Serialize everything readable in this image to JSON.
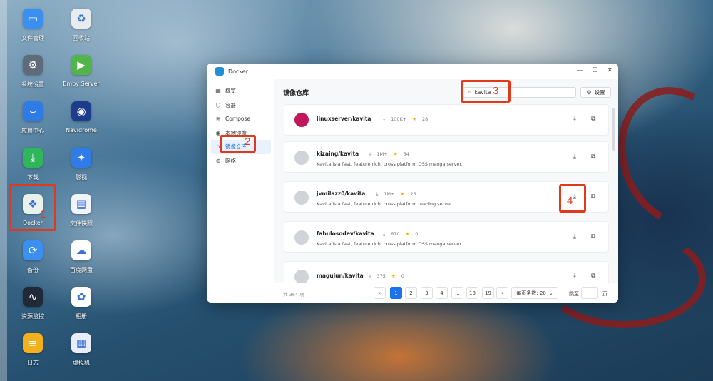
{
  "desktop": {
    "icons": [
      {
        "label": "文件管理",
        "icon": "folder-icon",
        "color": "#3b8ff0"
      },
      {
        "label": "回收站",
        "icon": "recycle-bin-icon",
        "color": "#e9ecef"
      },
      {
        "label": "系统设置",
        "icon": "gear-icon",
        "color": "#5f6b7a"
      },
      {
        "label": "Emby Server",
        "icon": "emby-play-icon",
        "color": "#52b54b"
      },
      {
        "label": "应用中心",
        "icon": "store-icon",
        "color": "#2f7ce8"
      },
      {
        "label": "Navidrome",
        "icon": "navidrome-disc-icon",
        "color": "#1c3d8c"
      },
      {
        "label": "下载",
        "icon": "download-arrow-icon",
        "color": "#2fb65a"
      },
      {
        "label": "影视",
        "icon": "film-icon",
        "color": "#2f7ce8"
      },
      {
        "label": "Docker",
        "icon": "docker-whale-icon",
        "color": "#e8f2ea"
      },
      {
        "label": "文件快照",
        "icon": "file-snapshot-icon",
        "color": "#f0f4fb"
      },
      {
        "label": "备份",
        "icon": "backup-sync-icon",
        "color": "#3b8ff0"
      },
      {
        "label": "百度网盘",
        "icon": "baidu-cloud-icon",
        "color": "#ffffff"
      },
      {
        "label": "资源监控",
        "icon": "monitor-chart-icon",
        "color": "#1f2937"
      },
      {
        "label": "相册",
        "icon": "photos-flower-icon",
        "color": "#ffffff"
      },
      {
        "label": "日志",
        "icon": "log-list-icon",
        "color": "#f2b01e"
      },
      {
        "label": "虚拟机",
        "icon": "virtual-machine-icon",
        "color": "#e8eef9"
      }
    ]
  },
  "annotations": [
    "1",
    "2",
    "3",
    "4"
  ],
  "window": {
    "title": "Docker",
    "controls": {
      "minimize": "—",
      "maximize": "☐",
      "close": "✕"
    },
    "sidebar": [
      {
        "label": "概览",
        "icon": "grid-icon",
        "active": false
      },
      {
        "label": "容器",
        "icon": "cube-icon",
        "active": false
      },
      {
        "label": "Compose",
        "icon": "compose-icon",
        "active": false
      },
      {
        "label": "本地镜像",
        "icon": "eye-icon",
        "active": false
      },
      {
        "label": "镜像仓库",
        "icon": "home-icon",
        "active": true
      },
      {
        "label": "网络",
        "icon": "globe-icon",
        "active": false
      }
    ],
    "main": {
      "title": "镜像仓库",
      "search_value": "kavita",
      "settings_label": "设置",
      "results": [
        {
          "name": "linuxserver/kavita",
          "downloads": "100K+",
          "stars": "28",
          "description": "",
          "logo_color": "#c2185b"
        },
        {
          "name": "kizaing/kavita",
          "downloads": "1M+",
          "stars": "54",
          "description": "Kavita is a fast, feature rich, cross platform OSS manga server.",
          "logo_color": "#d0d3d8"
        },
        {
          "name": "jvmilazz0/kavita",
          "downloads": "1M+",
          "stars": "25",
          "description": "Kavita is a fast, feature rich, cross platform reading server.",
          "logo_color": "#d0d3d8"
        },
        {
          "name": "fabulosodev/kavita",
          "downloads": "670",
          "stars": "0",
          "description": "Kavita is a fast, feature rich, cross platform OSS manga server.",
          "logo_color": "#d0d3d8"
        },
        {
          "name": "magujun/kavita",
          "downloads": "375",
          "stars": "0",
          "description": "",
          "logo_color": "#d0d3d8"
        }
      ]
    },
    "pagination": {
      "total": "共 364 项",
      "prev": "‹",
      "next": "›",
      "pages": [
        "1",
        "2",
        "3",
        "4",
        "...",
        "18",
        "19"
      ],
      "current": "1",
      "per_page": "每页条数: 20",
      "jump_label": "跳至",
      "page_suffix": "页"
    }
  }
}
